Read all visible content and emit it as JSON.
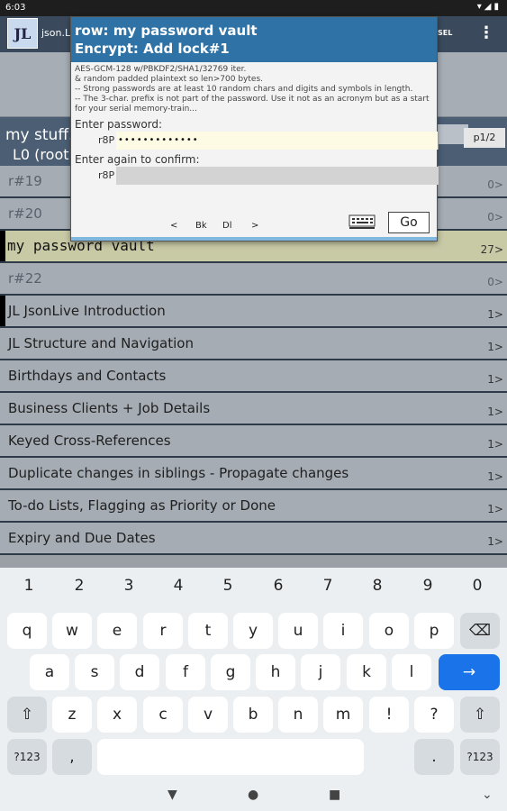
{
  "status": {
    "time": "6:03",
    "icons": "▾◢▮"
  },
  "appbar": {
    "logo": "JL",
    "title": "json.L",
    "sel": "SEL",
    "menu": "⋮"
  },
  "path": {
    "line1": "my stuff.j",
    "line2": "L0 (root)",
    "page": "p1/2"
  },
  "rows": [
    {
      "label": "r#19",
      "count": "0>"
    },
    {
      "label": "r#20",
      "count": "0>"
    },
    {
      "label": "my password vault",
      "count": "27>"
    },
    {
      "label": "r#22",
      "count": "0>"
    },
    {
      "label": "JL JsonLive Introduction",
      "count": "1>"
    },
    {
      "label": "JL Structure and Navigation",
      "count": "1>"
    },
    {
      "label": "Birthdays and Contacts",
      "count": "1>"
    },
    {
      "label": "Business Clients + Job Details",
      "count": "1>"
    },
    {
      "label": "Keyed Cross-References",
      "count": "1>"
    },
    {
      "label": "Duplicate changes in siblings - Propagate changes",
      "count": "1>"
    },
    {
      "label": "To-do Lists, Flagging as Priority or Done",
      "count": "1>"
    },
    {
      "label": "Expiry and Due Dates",
      "count": "1>"
    }
  ],
  "dialog": {
    "title1": "row: my password vault",
    "title2": "Encrypt: Add lock#1",
    "info1": "AES-GCM-128 w/PBKDF2/SHA1/32769 iter.",
    "info2": "& random padded plaintext so len>700 bytes.",
    "info3": "-- Strong passwords are at least 10 random chars and digits and symbols in length.",
    "info4": "-- The 3-char. prefix is not part of the password. Use it not as an acronym but as a start for your serial memory-train...",
    "enter_label": "Enter password:",
    "prefix1": "r8P",
    "password_mask": "•••••••••••••",
    "confirm_label": "Enter again to confirm:",
    "prefix2": "r8P",
    "nav_prev": "<",
    "nav_bk": "Bk",
    "nav_dl": "Dl",
    "nav_next": ">",
    "go": "Go"
  },
  "keyboard": {
    "numbers": [
      "1",
      "2",
      "3",
      "4",
      "5",
      "6",
      "7",
      "8",
      "9",
      "0"
    ],
    "row1": [
      "q",
      "w",
      "e",
      "r",
      "t",
      "y",
      "u",
      "i",
      "o",
      "p"
    ],
    "row2": [
      "a",
      "s",
      "d",
      "f",
      "g",
      "h",
      "j",
      "k",
      "l"
    ],
    "row3": [
      "z",
      "x",
      "c",
      "v",
      "b",
      "n",
      "m",
      "!",
      "?"
    ],
    "backspace": "⌫",
    "enter": "→",
    "shift": "⇧",
    "sym": "?123",
    "comma": ",",
    "period": "."
  },
  "navbar": {
    "back": "▼",
    "home": "●",
    "recents": "■",
    "ime": "⌄"
  }
}
